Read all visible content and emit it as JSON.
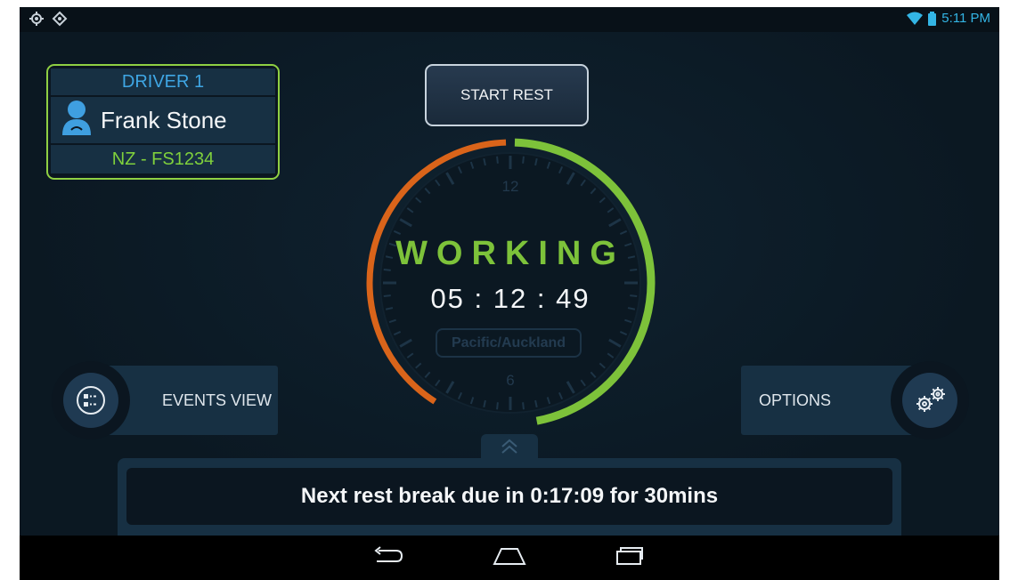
{
  "status_bar": {
    "left_icons": [
      "gps-icon",
      "location-icon"
    ],
    "right_icons": [
      "wifi-icon",
      "battery-icon"
    ],
    "time": "5:11 PM"
  },
  "driver": {
    "title": "DRIVER 1",
    "name": "Frank Stone",
    "id": "NZ - FS1234",
    "icon": "person-icon"
  },
  "start_rest": {
    "label": "START REST"
  },
  "dial": {
    "status": "WORKING",
    "time": "05 : 12 : 49",
    "timezone": "Pacific/Auckland",
    "label_12": "12",
    "label_6": "6",
    "work_fraction": 0.47,
    "rest_fraction": 0.41,
    "colors": {
      "work": "#7dc23a",
      "rest": "#d9641a"
    }
  },
  "events_view": {
    "label": "EVENTS VIEW",
    "icon": "list-icon"
  },
  "options": {
    "label": "OPTIONS",
    "icon": "gears-icon"
  },
  "panel_toggle": {
    "icon": "chevron-up-double-icon"
  },
  "next_rest": {
    "text": "Next rest break due in 0:17:09 for 30mins"
  },
  "navbar": {
    "icons": [
      "back-icon",
      "home-icon",
      "recent-apps-icon"
    ]
  },
  "colors": {
    "accent_blue": "#3fa6e4",
    "accent_green": "#7fd03c",
    "panel": "#173043",
    "background": "#0c1924"
  }
}
